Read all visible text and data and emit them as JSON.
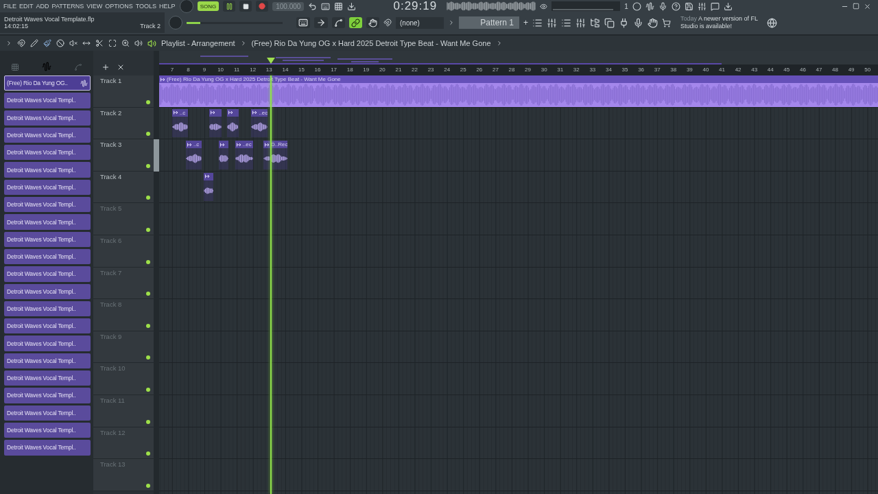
{
  "menu": [
    "FILE",
    "EDIT",
    "ADD",
    "PATTERNS",
    "VIEW",
    "OPTIONS",
    "TOOLS",
    "HELP"
  ],
  "transport": {
    "mode": "SONG",
    "song_mode": true,
    "playing": true,
    "tempo": "100.000",
    "time": "0:29:19",
    "meter_reading": "1"
  },
  "pitch_slider": {
    "level": 0.14
  },
  "hint": {
    "file": "Detroit Waves Vocal Template.flp",
    "time": "14:02:15",
    "focus": "Track 2"
  },
  "toolbar": {
    "link_on": true,
    "snap": "(none)",
    "pattern": "Pattern 1",
    "pattern_add": "+"
  },
  "news": {
    "date": "Today",
    "message": "A newer version of FL Studio is available!"
  },
  "playlist": {
    "title": "Playlist - Arrangement",
    "song": "(Free) Rio Da Yung OG x Hard 2025 Detroit Type Beat - Want Me Gone"
  },
  "clip_list": [
    {
      "name": "(Free) Rio Da Yung OG..",
      "selected": true
    },
    {
      "name": "Detroit Waves Vocal Templ..",
      "selected": false
    },
    {
      "name": "Detroit Waves Vocal Templ..",
      "selected": false
    },
    {
      "name": "Detroit Waves Vocal Templ..",
      "selected": false
    },
    {
      "name": "Detroit Waves Vocal Templ..",
      "selected": false
    },
    {
      "name": "Detroit Waves Vocal Templ..",
      "selected": false
    },
    {
      "name": "Detroit Waves Vocal Templ..",
      "selected": false
    },
    {
      "name": "Detroit Waves Vocal Templ..",
      "selected": false
    },
    {
      "name": "Detroit Waves Vocal Templ..",
      "selected": false
    },
    {
      "name": "Detroit Waves Vocal Templ..",
      "selected": false
    },
    {
      "name": "Detroit Waves Vocal Templ..",
      "selected": false
    },
    {
      "name": "Detroit Waves Vocal Templ..",
      "selected": false
    },
    {
      "name": "Detroit Waves Vocal Templ..",
      "selected": false
    },
    {
      "name": "Detroit Waves Vocal Templ..",
      "selected": false
    },
    {
      "name": "Detroit Waves Vocal Templ..",
      "selected": false
    },
    {
      "name": "Detroit Waves Vocal Templ..",
      "selected": false
    },
    {
      "name": "Detroit Waves Vocal Templ..",
      "selected": false
    },
    {
      "name": "Detroit Waves Vocal Templ..",
      "selected": false
    },
    {
      "name": "Detroit Waves Vocal Templ..",
      "selected": false
    },
    {
      "name": "Detroit Waves Vocal Templ..",
      "selected": false
    },
    {
      "name": "Detroit Waves Vocal Templ..",
      "selected": false
    },
    {
      "name": "Detroit Waves Vocal Templ..",
      "selected": false
    }
  ],
  "ruler": [
    "7",
    "8",
    "9",
    "10",
    "11",
    "12",
    "13",
    "14",
    "15",
    "16",
    "17",
    "18",
    "19",
    "20",
    "21",
    "22",
    "23",
    "24",
    "25",
    "26",
    "27",
    "28",
    "29",
    "30",
    "31",
    "32",
    "33",
    "34",
    "35",
    "36",
    "37",
    "38",
    "39",
    "40",
    "41",
    "42",
    "43",
    "44",
    "45",
    "46",
    "47",
    "48",
    "49",
    "50"
  ],
  "tracks": [
    {
      "name": "Track 1",
      "empty": false,
      "enabled": true,
      "clips": [
        {
          "kind": "audio",
          "label": "(Free) Rio Da Yung OG x Hard 2025 Detroit Type Beat - Want Me Gone"
        }
      ]
    },
    {
      "name": "Track 2",
      "empty": false,
      "enabled": true,
      "clips": [
        {
          "kind": "audio",
          "label": "..c"
        },
        {
          "kind": "audio"
        },
        {
          "kind": "audio"
        },
        {
          "kind": "audio",
          "label": "..ec"
        }
      ]
    },
    {
      "name": "Track 3",
      "empty": false,
      "enabled": true,
      "clips": [
        {
          "kind": "audio",
          "label": "..c"
        },
        {
          "kind": "audio"
        },
        {
          "kind": "audio",
          "label": "..ec"
        },
        {
          "kind": "audio",
          "label": "D..Rec"
        }
      ]
    },
    {
      "name": "Track 4",
      "empty": false,
      "enabled": true,
      "clips": [
        {
          "kind": "audio"
        }
      ]
    },
    {
      "name": "Track 5",
      "empty": true,
      "enabled": true
    },
    {
      "name": "Track 6",
      "empty": true,
      "enabled": true
    },
    {
      "name": "Track 7",
      "empty": true,
      "enabled": true
    },
    {
      "name": "Track 8",
      "empty": true,
      "enabled": true
    },
    {
      "name": "Track 9",
      "empty": true,
      "enabled": true
    },
    {
      "name": "Track 10",
      "empty": true,
      "enabled": true
    },
    {
      "name": "Track 11",
      "empty": true,
      "enabled": true
    },
    {
      "name": "Track 12",
      "empty": true,
      "enabled": true
    },
    {
      "name": "Track 13",
      "empty": true,
      "enabled": true
    }
  ]
}
